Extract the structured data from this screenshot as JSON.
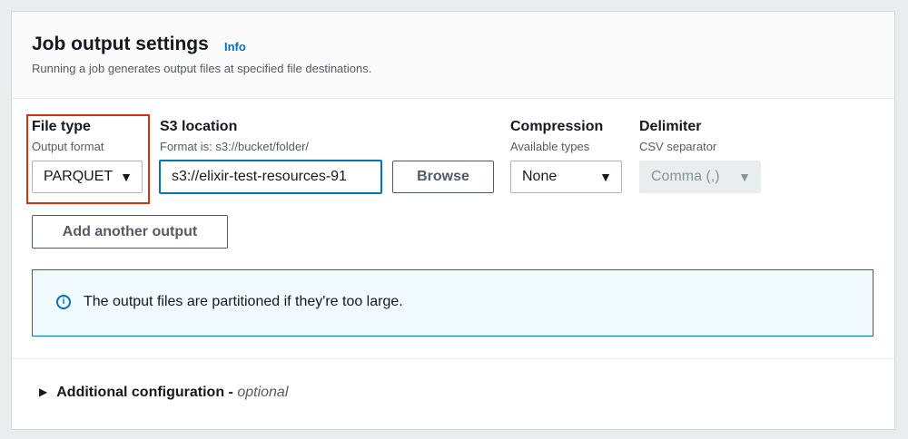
{
  "section": {
    "title": "Job output settings",
    "info_link": "Info",
    "description": "Running a job generates output files at specified file destinations."
  },
  "file_type": {
    "label": "File type",
    "sublabel": "Output format",
    "selected": "PARQUET"
  },
  "s3_location": {
    "label": "S3 location",
    "sublabel": "Format is: s3://bucket/folder/",
    "value": "s3://elixir-test-resources-91",
    "browse_label": "Browse"
  },
  "compression": {
    "label": "Compression",
    "sublabel": "Available types",
    "selected": "None"
  },
  "delimiter": {
    "label": "Delimiter",
    "sublabel": "CSV separator",
    "selected": "Comma (,)"
  },
  "add_output_label": "Add another output",
  "alert": {
    "icon": "info-icon",
    "text": "The output files are partitioned if they're too large."
  },
  "additional_config": {
    "label": "Additional configuration - ",
    "optional": "optional"
  },
  "colors": {
    "link": "#0073bb",
    "highlight_border": "#d13212",
    "alert_background": "#f1faff"
  }
}
